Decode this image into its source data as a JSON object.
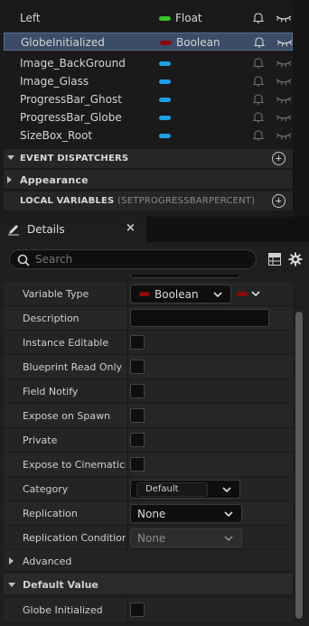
{
  "variables": [
    {
      "name": "Left",
      "type_label": "Float",
      "pill_color": "#37c228",
      "selected": false,
      "bell_dim": false,
      "eye_dim": false
    },
    {
      "name": "GlobeInitialized",
      "type_label": "Boolean",
      "pill_color": "#8b0a0a",
      "selected": true,
      "bell_dim": false,
      "eye_dim": false
    },
    {
      "name": "Image_BackGround",
      "type_label": "",
      "pill_color": "#1f9ee6",
      "selected": false,
      "bell_dim": true,
      "eye_dim": true
    },
    {
      "name": "Image_Glass",
      "type_label": "",
      "pill_color": "#1f9ee6",
      "selected": false,
      "bell_dim": true,
      "eye_dim": true
    },
    {
      "name": "ProgressBar_Ghost",
      "type_label": "",
      "pill_color": "#1f9ee6",
      "selected": false,
      "bell_dim": true,
      "eye_dim": true
    },
    {
      "name": "ProgressBar_Globe",
      "type_label": "",
      "pill_color": "#1f9ee6",
      "selected": false,
      "bell_dim": true,
      "eye_dim": true
    },
    {
      "name": "SizeBox_Root",
      "type_label": "",
      "pill_color": "#1f9ee6",
      "selected": false,
      "bell_dim": true,
      "eye_dim": true
    }
  ],
  "sections": {
    "event_dispatchers": "EVENT DISPATCHERS",
    "appearance": "Appearance",
    "local_variables": "LOCAL VARIABLES",
    "local_variables_context": "(SETPROGRESSBARPERCENT)"
  },
  "details_tab": {
    "label": "Details",
    "close_glyph": "×"
  },
  "search": {
    "placeholder": "Search"
  },
  "properties": {
    "variable_type": {
      "label": "Variable Type",
      "value": "Boolean",
      "pill_color": "#8b0a0a"
    },
    "description": {
      "label": "Description",
      "value": ""
    },
    "instance_editable": {
      "label": "Instance Editable"
    },
    "blueprint_read_only": {
      "label": "Blueprint Read Only"
    },
    "field_notify": {
      "label": "Field Notify"
    },
    "expose_on_spawn": {
      "label": "Expose on Spawn"
    },
    "private": {
      "label": "Private"
    },
    "expose_to_cinematics": {
      "label": "Expose to Cinematics"
    },
    "category": {
      "label": "Category",
      "value": "Default"
    },
    "replication": {
      "label": "Replication",
      "value": "None"
    },
    "replication_condition": {
      "label": "Replication Condition",
      "value": "None"
    }
  },
  "advanced": {
    "label": "Advanced"
  },
  "default_value": {
    "label": "Default Value",
    "field_label": "Globe Initialized"
  }
}
